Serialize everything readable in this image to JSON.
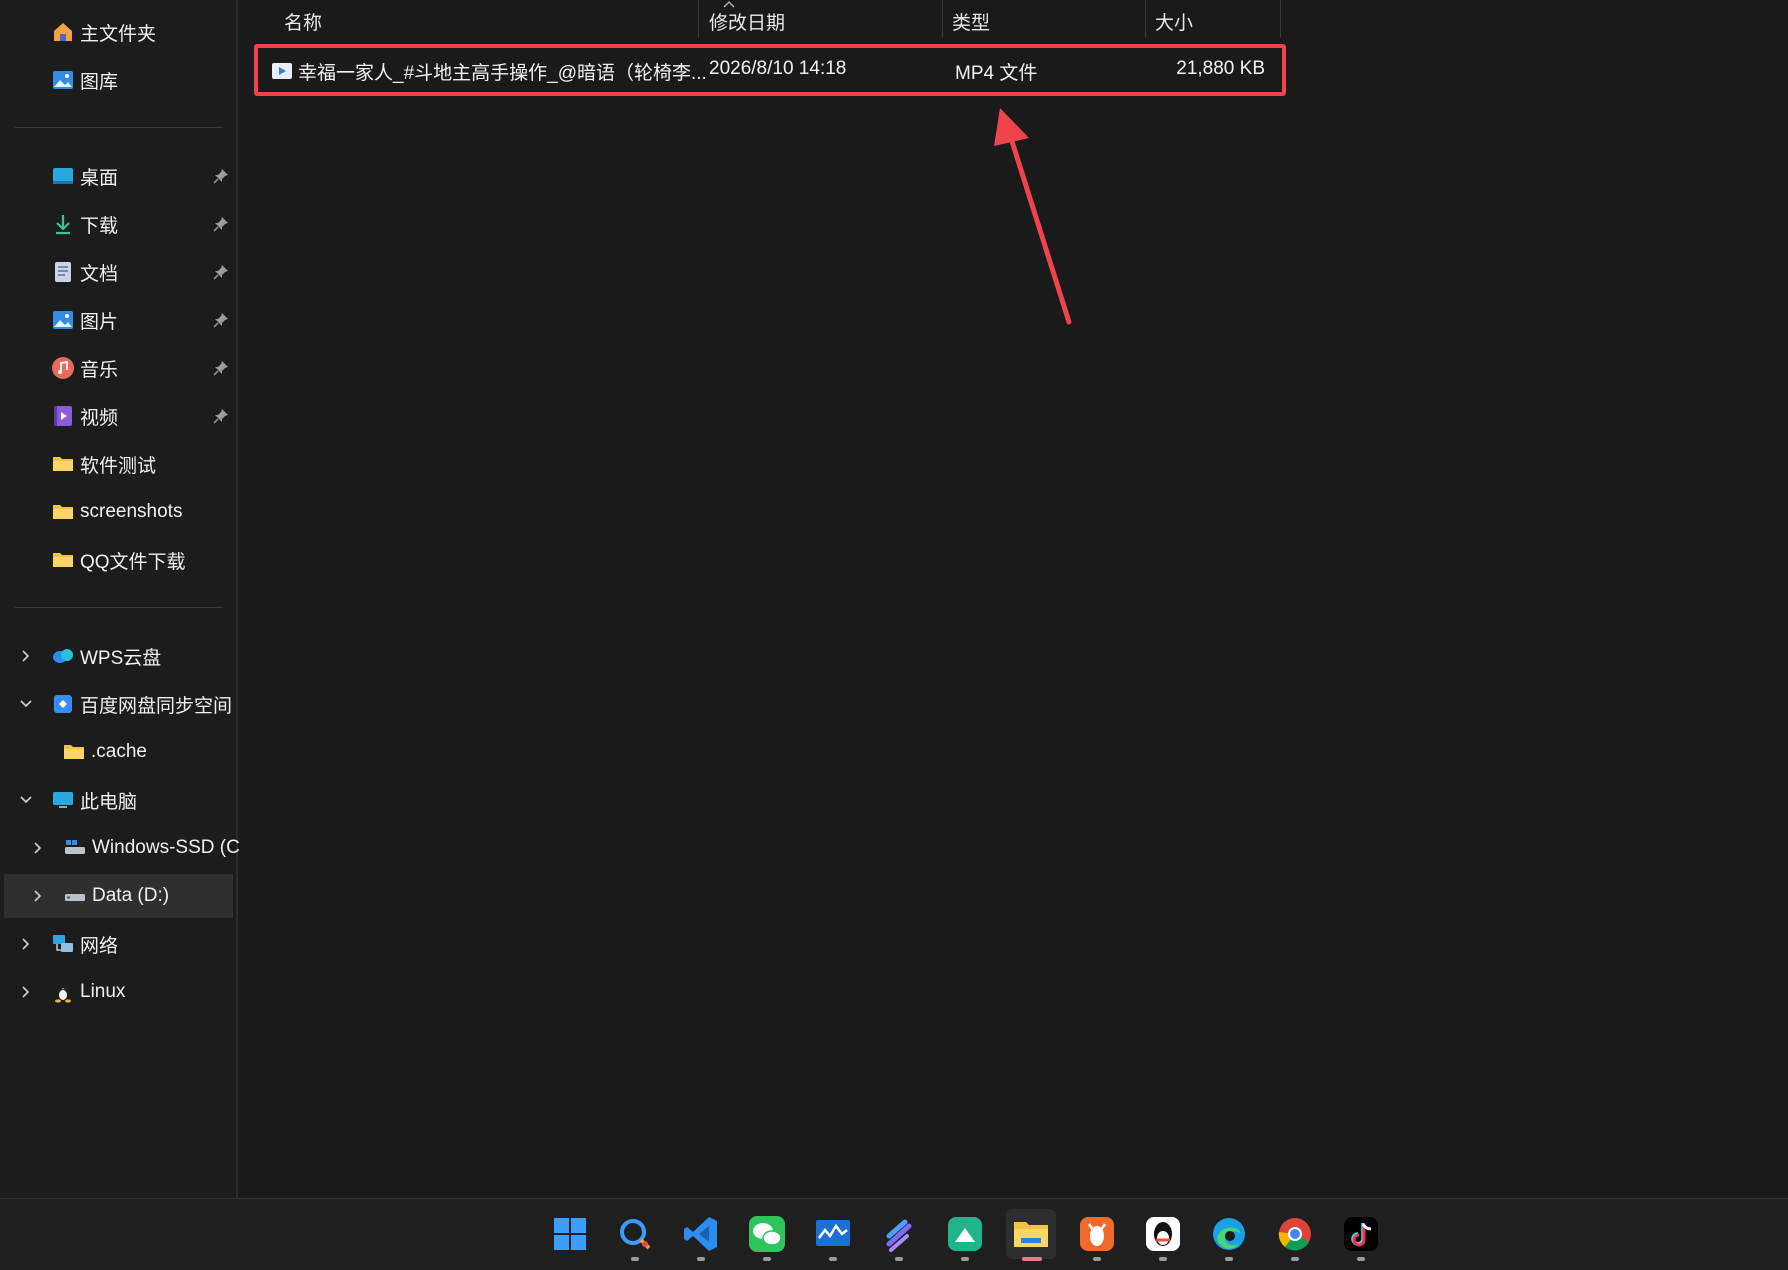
{
  "sidebar": {
    "quick": [
      {
        "label": "主文件夹",
        "icon": "home-icon"
      },
      {
        "label": "图库",
        "icon": "gallery-icon"
      }
    ],
    "pinned": [
      {
        "label": "桌面",
        "icon": "desktop-icon"
      },
      {
        "label": "下载",
        "icon": "download-icon"
      },
      {
        "label": "文档",
        "icon": "document-icon"
      },
      {
        "label": "图片",
        "icon": "pictures-icon"
      },
      {
        "label": "音乐",
        "icon": "music-icon"
      },
      {
        "label": "视频",
        "icon": "video-icon"
      }
    ],
    "folders": [
      {
        "label": "软件测试",
        "icon": "folder-icon"
      },
      {
        "label": "screenshots",
        "icon": "folder-icon"
      },
      {
        "label": "QQ文件下载",
        "icon": "folder-icon"
      }
    ],
    "tree": [
      {
        "label": "WPS云盘",
        "icon": "cloud-icon",
        "chevron": "right"
      },
      {
        "label": "百度网盘同步空间",
        "icon": "baidu-sync-icon",
        "chevron": "down"
      },
      {
        "label": ".cache",
        "icon": "folder-icon",
        "chevron": ""
      },
      {
        "label": "此电脑",
        "icon": "computer-icon",
        "chevron": "down"
      },
      {
        "label": "Windows-SSD (C",
        "icon": "drive-icon",
        "chevron": "right"
      },
      {
        "label": "Data (D:)",
        "icon": "drive-icon",
        "chevron": "right",
        "selected": true
      },
      {
        "label": "网络",
        "icon": "network-icon",
        "chevron": "right"
      },
      {
        "label": "Linux",
        "icon": "linux-icon",
        "chevron": "right"
      }
    ]
  },
  "columns": {
    "name": "名称",
    "date": "修改日期",
    "type": "类型",
    "size": "大小"
  },
  "file": {
    "name": "幸福一家人_#斗地主高手操作_@暗语（轮椅李...",
    "date": "2026/8/10 14:18",
    "type": "MP4 文件",
    "size": "21,880 KB",
    "icon": "video-file-icon"
  },
  "annotation": {
    "color": "#f0434b"
  },
  "taskbar": [
    {
      "name": "start-icon"
    },
    {
      "name": "search-chat-icon"
    },
    {
      "name": "vscode-icon"
    },
    {
      "name": "wechat-icon"
    },
    {
      "name": "monitor-app-icon"
    },
    {
      "name": "feishu-icon"
    },
    {
      "name": "tablet-app-icon"
    },
    {
      "name": "file-explorer-icon",
      "active": true
    },
    {
      "name": "lobster-app-icon"
    },
    {
      "name": "qq-icon"
    },
    {
      "name": "edge-icon"
    },
    {
      "name": "chrome-icon"
    },
    {
      "name": "tiktok-icon"
    }
  ]
}
